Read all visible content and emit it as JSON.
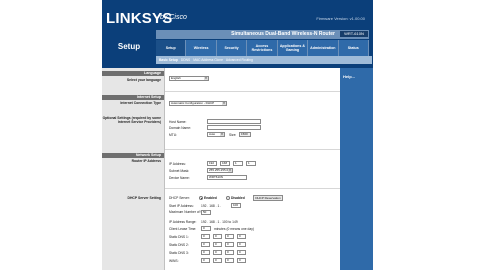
{
  "brand": {
    "logo": "LINKSYS",
    "by": "by Cisco"
  },
  "firmware": "Firmware Version: v1.00.00",
  "product": {
    "name": "Simultaneous Dual-Band Wireless-N Router",
    "model": "WRT-610N"
  },
  "section": "Setup",
  "tabs": [
    "Setup",
    "Wireless",
    "Security",
    "Access Restrictions",
    "Applications & Gaming",
    "Administration",
    "Status"
  ],
  "subtabs": [
    "Basic Setup",
    "DDNS",
    "MAC Address Clone",
    "Advanced Routing"
  ],
  "left": {
    "language_header": "Language",
    "select_language": "Select your language",
    "internet_setup_header": "Internet Setup",
    "internet_connection_type": "Internet Connection Type",
    "optional_settings": "Optional Settings (required by some Internet Service Providers)",
    "network_setup_header": "Network Setup",
    "router_ip": "Router IP Address",
    "dhcp_settings": "DHCP Server Setting"
  },
  "main": {
    "language_value": "English",
    "connection_type": "Automatic Configuration - DHCP",
    "host_name_label": "Host Name:",
    "domain_name_label": "Domain Name:",
    "mtu_label": "MTU:",
    "mtu_mode": "Auto",
    "mtu_size_label": "Size:",
    "mtu_size": "1500",
    "ip_address_label": "IP Address:",
    "ip_address": [
      "192",
      "168",
      "1",
      "1"
    ],
    "subnet_mask_label": "Subnet Mask:",
    "subnet_mask": "255.255.255.0",
    "device_name_label": "Device Name:",
    "device_name": "WRT610N",
    "dhcp_server_label": "DHCP Server:",
    "enabled": "Enabled",
    "disabled": "Disabled",
    "dhcp_reservation": "DHCP Reservation",
    "start_ip_label": "Start IP Address:",
    "start_ip_prefix": "192 . 168 . 1 .",
    "start_ip_last": "100",
    "max_users_label": "Maximum Number of Users:",
    "max_users": "50",
    "ip_range_label": "IP Address Range:",
    "ip_range_value": "192 . 168 . 1 . 100 to 149",
    "lease_time_label": "Client Lease Time:",
    "lease_time": "0",
    "lease_note": "minutes (0 means one day)",
    "dns1_label": "Static DNS 1:",
    "dns2_label": "Static DNS 2:",
    "dns3_label": "Static DNS 3:",
    "wins_label": "WINS:",
    "zero": "0"
  },
  "help": {
    "title": "Help..."
  },
  "colors": {
    "header_navy": "#0b3f7a",
    "tab_blue": "#2f6aa9",
    "help_blue": "#2f6aa9"
  }
}
